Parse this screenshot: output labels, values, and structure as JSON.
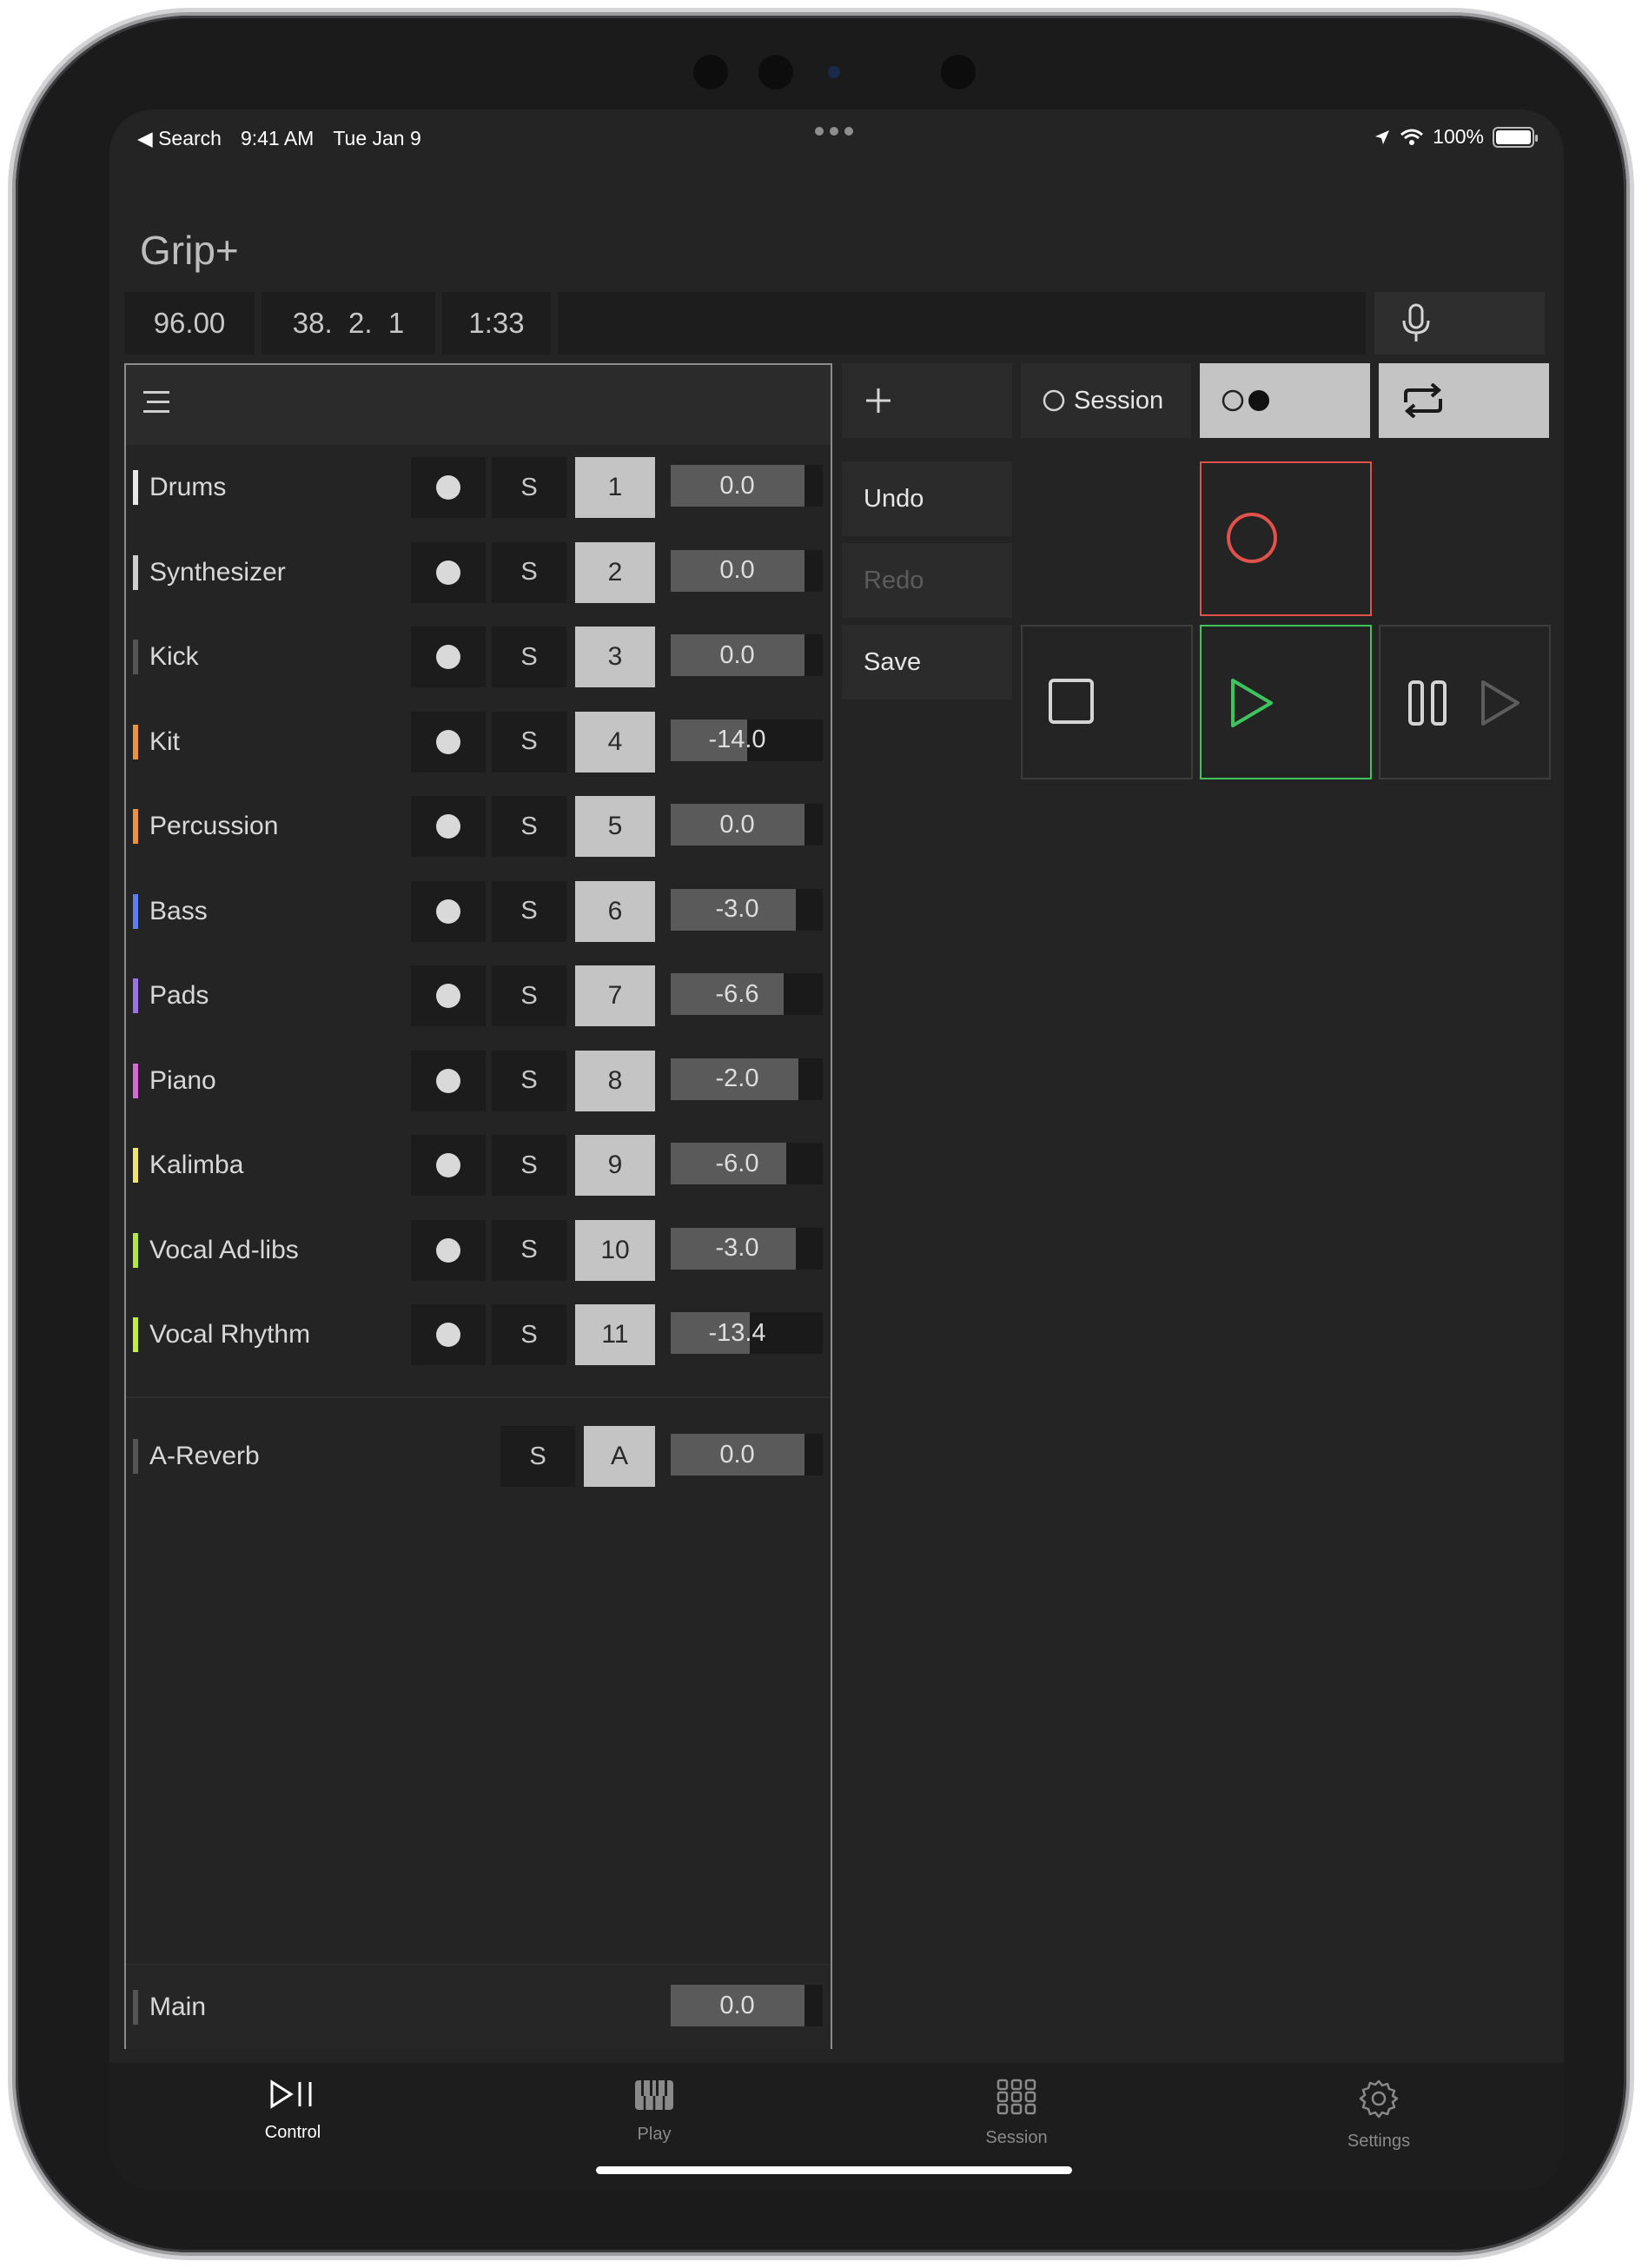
{
  "status_bar": {
    "back_label": "◀ Search",
    "time": "9:41 AM",
    "date": "Tue Jan 9",
    "battery": "100%"
  },
  "app": {
    "title": "Grip+"
  },
  "transport": {
    "tempo": "96.00",
    "position": "38.  2.  1",
    "time": "1:33"
  },
  "toolbar": {
    "session_label": "Session",
    "undo_label": "Undo",
    "redo_label": "Redo",
    "save_label": "Save"
  },
  "tracks": [
    {
      "name": "Drums",
      "color": "#e8e8e8",
      "solo": "S",
      "number": "1",
      "volume": "0.0",
      "level": 0.88
    },
    {
      "name": "Synthesizer",
      "color": "#cfcfcf",
      "solo": "S",
      "number": "2",
      "volume": "0.0",
      "level": 0.88
    },
    {
      "name": "Kick",
      "color": "#555555",
      "solo": "S",
      "number": "3",
      "volume": "0.0",
      "level": 0.88
    },
    {
      "name": "Kit",
      "color": "#f0923a",
      "solo": "S",
      "number": "4",
      "volume": "-14.0",
      "level": 0.5
    },
    {
      "name": "Percussion",
      "color": "#f0923a",
      "solo": "S",
      "number": "5",
      "volume": "0.0",
      "level": 0.88
    },
    {
      "name": "Bass",
      "color": "#5e7ff0",
      "solo": "S",
      "number": "6",
      "volume": "-3.0",
      "level": 0.82
    },
    {
      "name": "Pads",
      "color": "#9b73e8",
      "solo": "S",
      "number": "7",
      "volume": "-6.6",
      "level": 0.74
    },
    {
      "name": "Piano",
      "color": "#d86ad8",
      "solo": "S",
      "number": "8",
      "volume": "-2.0",
      "level": 0.84
    },
    {
      "name": "Kalimba",
      "color": "#f2e36b",
      "solo": "S",
      "number": "9",
      "volume": "-6.0",
      "level": 0.76
    },
    {
      "name": "Vocal Ad-libs",
      "color": "#b4e83a",
      "solo": "S",
      "number": "10",
      "volume": "-3.0",
      "level": 0.82
    },
    {
      "name": "Vocal Rhythm",
      "color": "#c8ec3a",
      "solo": "S",
      "number": "11",
      "volume": "-13.4",
      "level": 0.52
    }
  ],
  "return_track": {
    "name": "A-Reverb",
    "color": "#555555",
    "solo": "S",
    "send": "A",
    "volume": "0.0",
    "level": 0.88
  },
  "main_track": {
    "name": "Main",
    "color": "#555555",
    "volume": "0.0",
    "level": 0.88
  },
  "tabs": [
    {
      "label": "Control",
      "icon": "play-pause-icon",
      "active": true
    },
    {
      "label": "Play",
      "icon": "piano-icon",
      "active": false
    },
    {
      "label": "Session",
      "icon": "grid-icon",
      "active": false
    },
    {
      "label": "Settings",
      "icon": "gear-icon",
      "active": false
    }
  ],
  "colors": {
    "background": "#242424",
    "record": "#e0524a",
    "play": "#3ec45e",
    "active_button": "#c4c4c4"
  }
}
